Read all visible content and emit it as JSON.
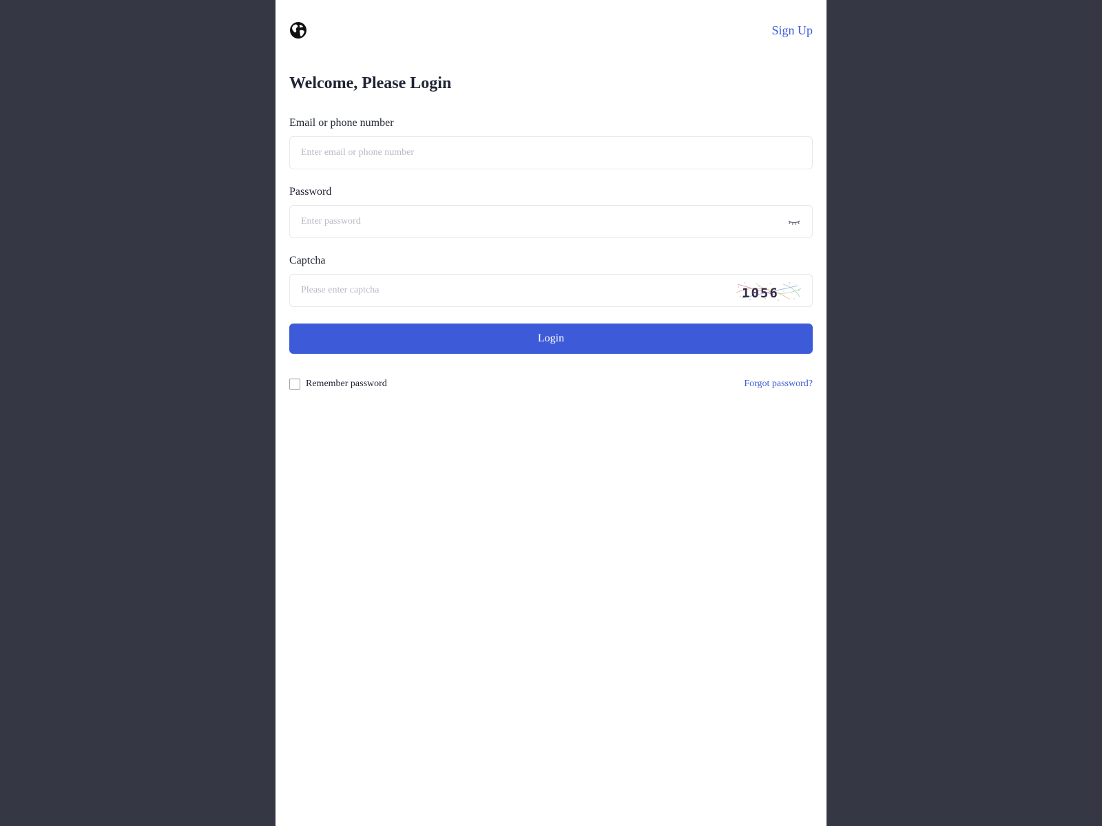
{
  "header": {
    "logo_icon": "globe-icon",
    "signup_label": "Sign Up"
  },
  "title": "Welcome, Please Login",
  "form": {
    "email": {
      "label": "Email or phone number",
      "placeholder": "Enter email or phone number",
      "value": ""
    },
    "password": {
      "label": "Password",
      "placeholder": "Enter password",
      "value": "",
      "toggle_icon": "eye-closed-icon"
    },
    "captcha": {
      "label": "Captcha",
      "placeholder": "Please enter captcha",
      "value": "",
      "image_text": "1056"
    },
    "login_label": "Login",
    "remember_label": "Remember password",
    "remember_checked": false,
    "forgot_label": "Forgot password?"
  },
  "colors": {
    "background": "#353744",
    "panel": "#ffffff",
    "accent": "#3d5bd9",
    "text": "#1f2433",
    "placeholder": "#b8bcc6",
    "border": "#e6e8ee"
  }
}
